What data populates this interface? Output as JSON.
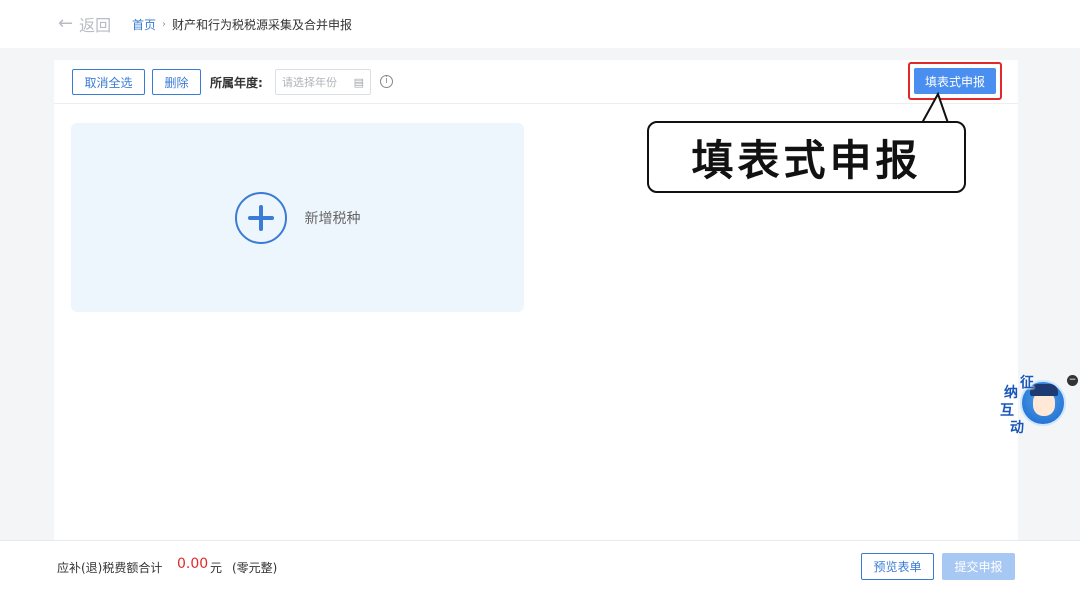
{
  "header": {
    "back_label": "返回",
    "breadcrumb": {
      "home": "首页",
      "separator": "›",
      "current": "财产和行为税税源采集及合并申报"
    }
  },
  "toolbar": {
    "cancel_all_label": "取消全选",
    "delete_label": "删除",
    "year_label": "所属年度:",
    "year_placeholder": "请选择年份",
    "info_icon": "info-icon",
    "fill_form_label": "填表式申报"
  },
  "add_card": {
    "label": "新增税种",
    "icon": "plus-circle-icon"
  },
  "callout": {
    "text": "填表式申报"
  },
  "assistant": {
    "chars": [
      "征",
      "纳",
      "互",
      "动"
    ],
    "collapse_symbol": "−"
  },
  "footer": {
    "total_label": "应补(退)税费额合计",
    "total_amount": "0.00",
    "total_unit": "元",
    "total_words": "(零元整)",
    "preview_label": "预览表单",
    "submit_label": "提交申报"
  },
  "colors": {
    "accent": "#3a7bd5",
    "primary_button": "#4a8ef0",
    "highlight_border": "#e02a2a",
    "amount": "#e02a2a",
    "disabled_button": "#a8c8f4",
    "card_bg": "#eef6fd"
  }
}
